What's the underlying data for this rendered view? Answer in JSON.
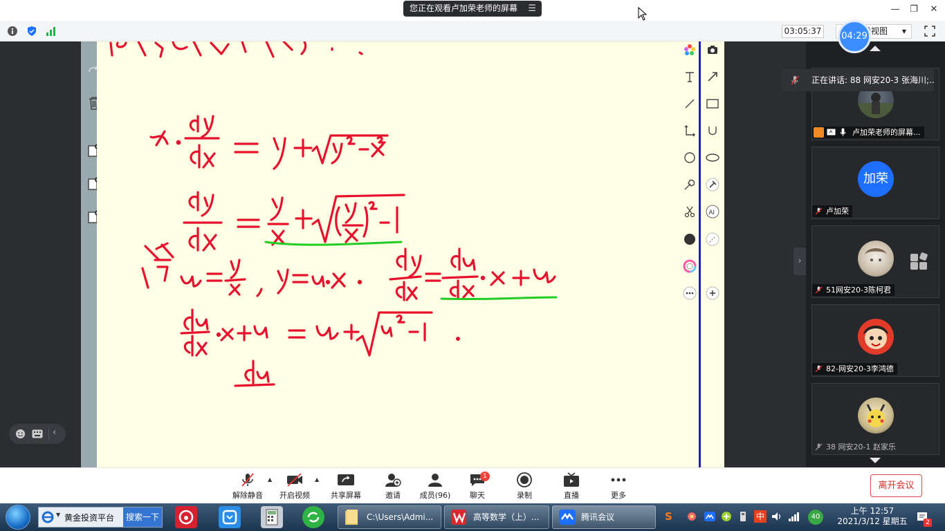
{
  "topbar": {
    "sharing_text": "您正在观看卢加荣老师的屏幕",
    "menu_icon": "list-icon",
    "window_controls": [
      "minimize-icon",
      "restore-icon",
      "close-icon"
    ]
  },
  "infobar": {
    "icons": [
      "info-icon",
      "shield-icon",
      "signal-icon"
    ],
    "timer": "03:05:37",
    "view_label": "看视图",
    "badge_time": "04:29"
  },
  "board": {
    "side_tools": [
      "redo-icon",
      "trash-icon",
      "add-page-icon",
      "remove-page-icon",
      "page-more-icon"
    ],
    "math_lines": [
      "解: 齐次微分方程.",
      "x · dy/dx = y + √(y² − x²)",
      "dy/dx = y/x + √((y/x)² − 1)",
      "令 u = y/x ,  y = u·x ,  dy/dx = du/dx · x + u",
      "du/dx · x + u = u + √(u² − 1)",
      "du"
    ],
    "tools_left": [
      "color-palette-icon",
      "text-icon",
      "line-icon",
      "axis-icon",
      "circle-icon",
      "brush-icon",
      "scissors-icon",
      "fill-dot-icon",
      "color-ring-icon",
      "more-dots-icon"
    ],
    "tools_right": [
      "camera-icon",
      "arrow-icon",
      "rectangle-icon",
      "u-shape-icon",
      "ellipse-icon",
      "hammer-icon",
      "ai-icon",
      "eraser-icon",
      "plus-icon"
    ],
    "ink_color": "#e8112d",
    "underline_color": "#22cc22",
    "line_color": "#1d22b8"
  },
  "speaking": {
    "text": "正在讲话: 88 网安20-3 张海川;..."
  },
  "participants": [
    {
      "name": "卢加荣老师的屏幕...",
      "avatar": "photo",
      "icons": [
        "host-icon",
        "share-screen-icon",
        "mic-on-icon"
      ]
    },
    {
      "name": "卢加荣",
      "avatar_text": "加荣",
      "avatar_color": "#1e6fff"
    },
    {
      "name": "51网安20-3陈柯君",
      "avatar": "photo"
    },
    {
      "name": "82-网安20-3李鸿德",
      "avatar": "photo"
    },
    {
      "name": "38 网安20-1 赵家乐",
      "avatar": "photo"
    }
  ],
  "toolbar": {
    "buttons": [
      {
        "label": "解除静音",
        "icon": "mic-muted-icon"
      },
      {
        "label": "开启视频",
        "icon": "video-off-icon"
      },
      {
        "label": "共享屏幕",
        "icon": "share-screen-icon"
      },
      {
        "label": "邀请",
        "icon": "invite-icon"
      },
      {
        "label": "成员(96)",
        "icon": "members-icon"
      },
      {
        "label": "聊天",
        "icon": "chat-icon"
      },
      {
        "label": "录制",
        "icon": "record-icon"
      },
      {
        "label": "直播",
        "icon": "live-icon"
      },
      {
        "label": "更多",
        "icon": "more-icon"
      }
    ],
    "chat_badge": "1",
    "leave_label": "离开会议"
  },
  "taskbar": {
    "ie_label": "黄金投资平台",
    "search_label": "搜索一下",
    "tasks": [
      {
        "label": "C:\\Users\\Admi...",
        "icon": "folder-icon"
      },
      {
        "label": "高等数学（上）...",
        "icon": "wps-icon"
      },
      {
        "label": "腾讯会议",
        "icon": "tencent-meeting-icon"
      }
    ],
    "tray_badge": "40",
    "tray_lang": "中",
    "clock_time": "上午 12:57",
    "clock_date": "2021/3/12 星期五",
    "notify_count": "2"
  },
  "accent_color": "#1e6fff",
  "leave_color": "#d72c2c"
}
